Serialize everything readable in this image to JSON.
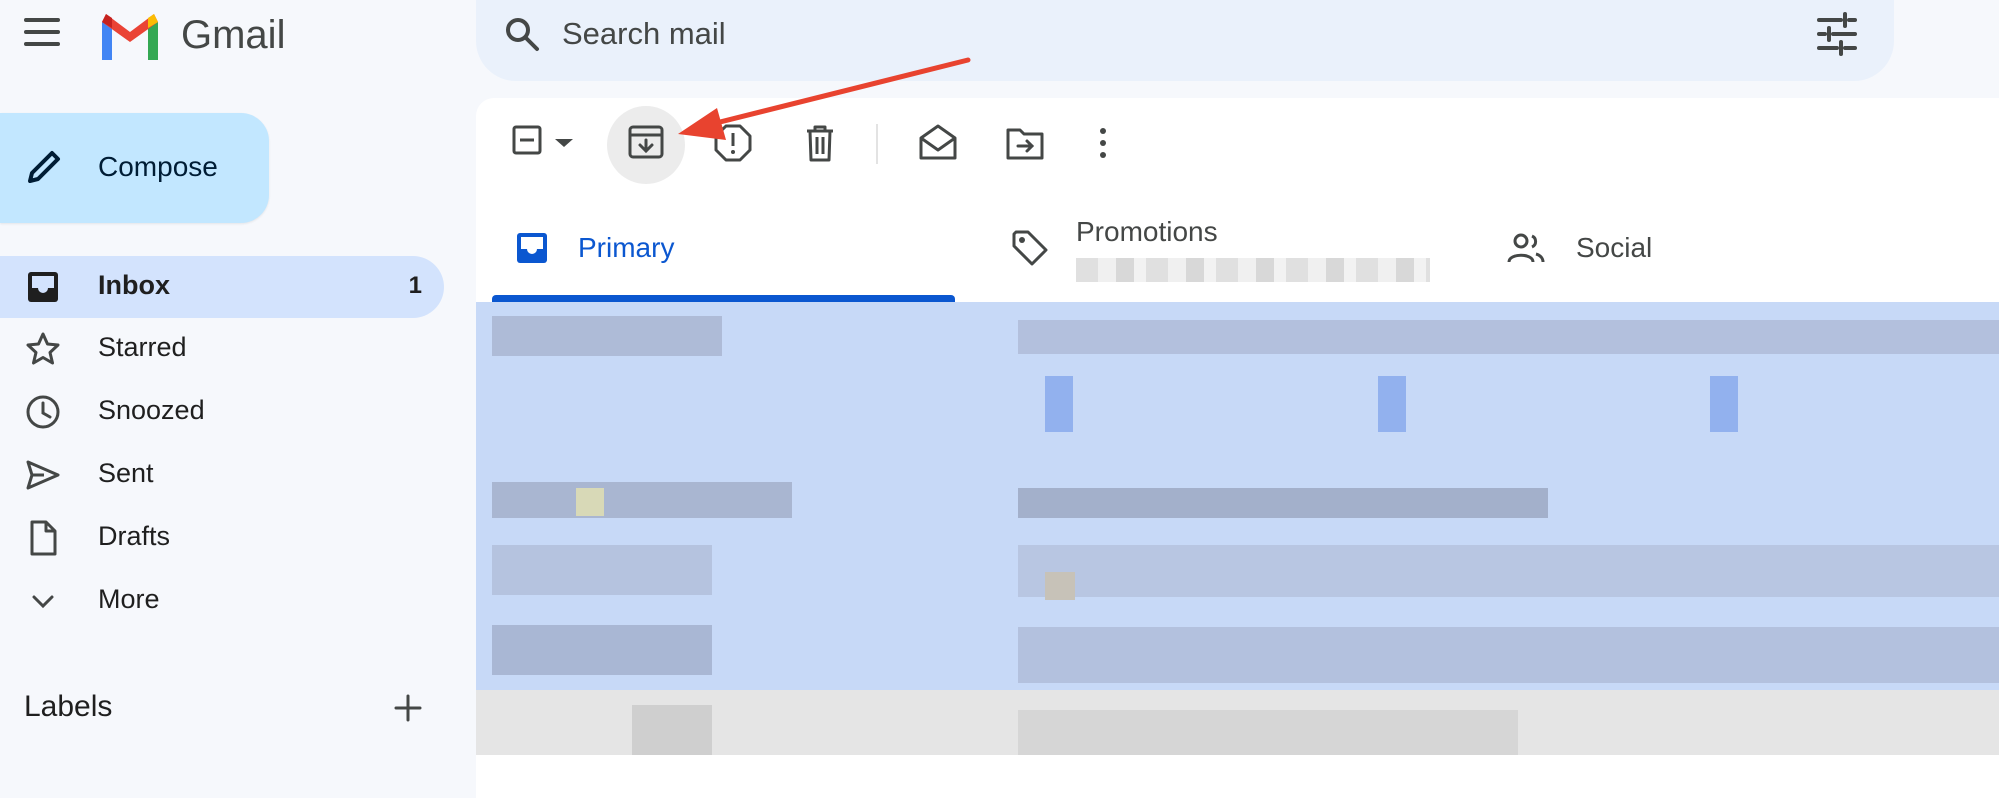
{
  "app": {
    "name": "Gmail"
  },
  "search": {
    "placeholder": "Search mail"
  },
  "compose": {
    "label": "Compose"
  },
  "sidebar": {
    "items": [
      {
        "label": "Inbox",
        "count": "1",
        "icon": "inbox-icon",
        "active": true
      },
      {
        "label": "Starred",
        "icon": "star-icon"
      },
      {
        "label": "Snoozed",
        "icon": "clock-icon"
      },
      {
        "label": "Sent",
        "icon": "send-icon"
      },
      {
        "label": "Drafts",
        "icon": "draft-icon"
      },
      {
        "label": "More",
        "icon": "chevron-down-icon"
      }
    ],
    "labels_title": "Labels"
  },
  "toolbar": {
    "buttons": [
      "select-checkbox",
      "select-dropdown",
      "archive",
      "report-spam",
      "delete",
      "mark-as-read",
      "move-to",
      "more-options"
    ],
    "highlighted": "archive"
  },
  "tabs": [
    {
      "label": "Primary",
      "icon": "inbox-icon",
      "active": true
    },
    {
      "label": "Promotions",
      "icon": "tag-icon"
    },
    {
      "label": "Social",
      "icon": "people-icon"
    }
  ],
  "colors": {
    "accent": "#0b57d0",
    "compose_bg": "#c2e7ff",
    "active_nav": "#d3e3fd",
    "selected_rows": "#c7d9f7",
    "annotation_arrow": "#e8432f"
  }
}
